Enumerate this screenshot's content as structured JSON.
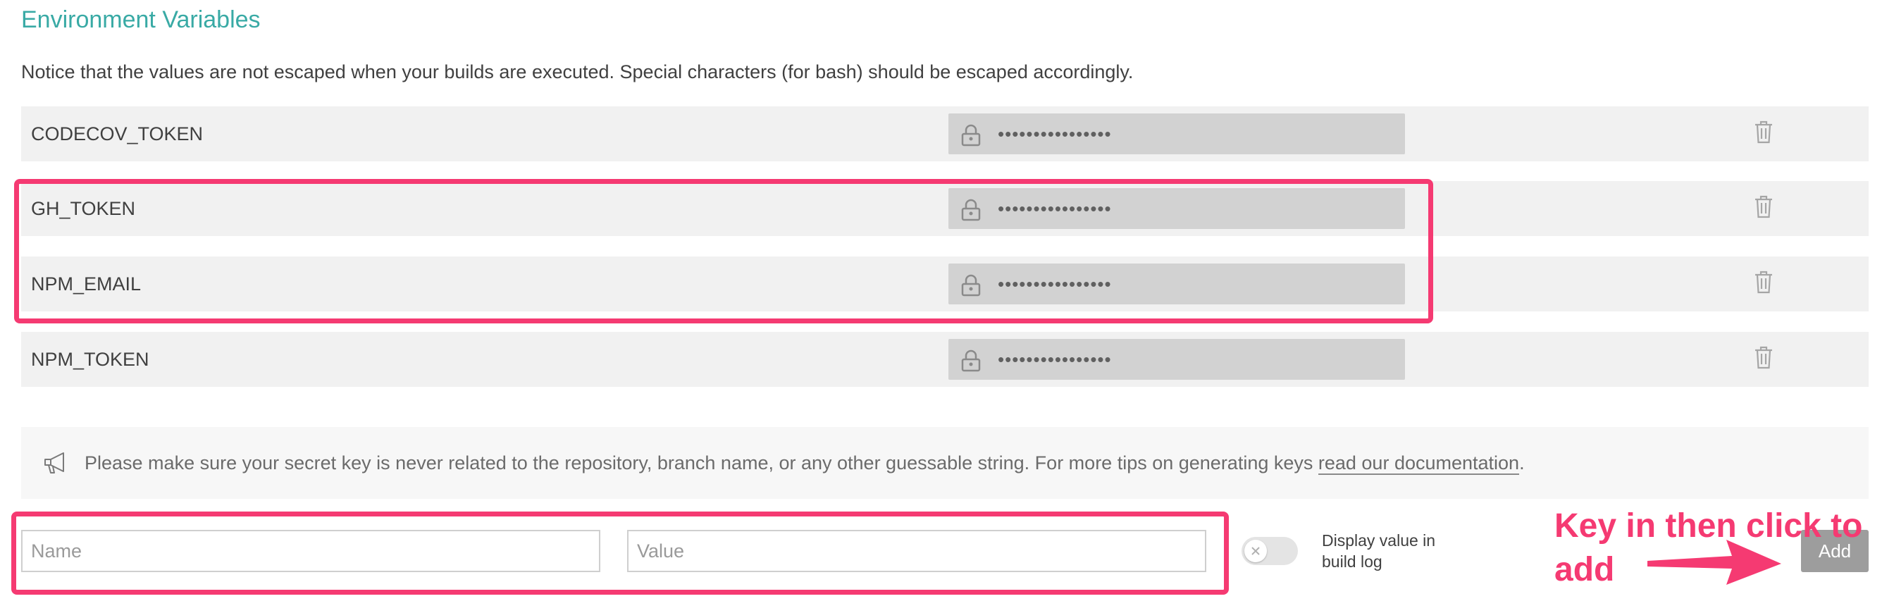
{
  "page": {
    "title": "Environment Variables",
    "notice": "Notice that the values are not escaped when your builds are executed. Special characters (for bash) should be escaped accordingly."
  },
  "env_vars": [
    {
      "name": "CODECOV_TOKEN",
      "value": "••••••••••••••••"
    },
    {
      "name": "GH_TOKEN",
      "value": "••••••••••••••••"
    },
    {
      "name": "NPM_EMAIL",
      "value": "••••••••••••••••"
    },
    {
      "name": "NPM_TOKEN",
      "value": "••••••••••••••••"
    }
  ],
  "tip": {
    "text": "Please make sure your secret key is never related to the repository, branch name, or any other guessable string. For more tips on generating keys ",
    "link": "read our documentation",
    "suffix": "."
  },
  "form": {
    "name_placeholder": "Name",
    "value_placeholder": "Value",
    "toggle_label": "Display value in build log",
    "toggle_on": false,
    "add_label": "Add"
  },
  "annotation": {
    "text": "Key in then click to add",
    "color": "#f53a72"
  },
  "colors": {
    "accent": "#39aaa5",
    "highlight": "#f53a72",
    "row_bg": "#f1f1f1",
    "value_bg": "#d2d2d2"
  },
  "icons": [
    "lock-icon",
    "trash-icon",
    "megaphone-icon",
    "x-icon",
    "arrow-icon"
  ]
}
